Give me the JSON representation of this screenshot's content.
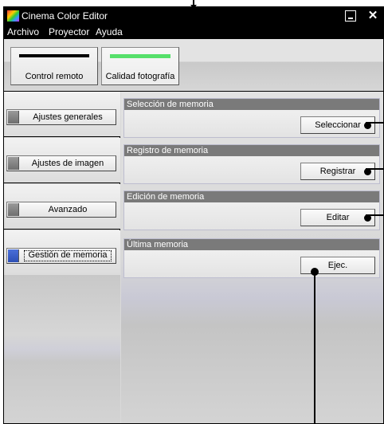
{
  "window": {
    "title": "Cinema Color Editor"
  },
  "menu": {
    "items": [
      "Archivo",
      "Proyector",
      "Ayuda"
    ]
  },
  "top_buttons": {
    "remote_label": "Control remoto",
    "photo_label": "Calidad fotografía"
  },
  "nav": {
    "items": [
      {
        "label": "Ajustes generales",
        "active": false
      },
      {
        "label": "Ajustes de imagen",
        "active": false
      },
      {
        "label": "Avanzado",
        "active": false
      },
      {
        "label": "Gestión de memoria",
        "active": true
      }
    ]
  },
  "memory": {
    "sections": [
      {
        "title": "Selección de memoria",
        "button": "Seleccionar"
      },
      {
        "title": "Registro de memoria",
        "button": "Registrar"
      },
      {
        "title": "Edición de memoria",
        "button": "Editar"
      },
      {
        "title": "Última memoria",
        "button": "Ejec."
      }
    ]
  },
  "colors": {
    "title_bar": "#000000",
    "active_indicator": "#3355c4",
    "photo_quality_bar": "#56e06a"
  },
  "icons": {
    "app": "color-spectrum-icon",
    "minimize": "minimize-icon",
    "close": "close-icon"
  }
}
